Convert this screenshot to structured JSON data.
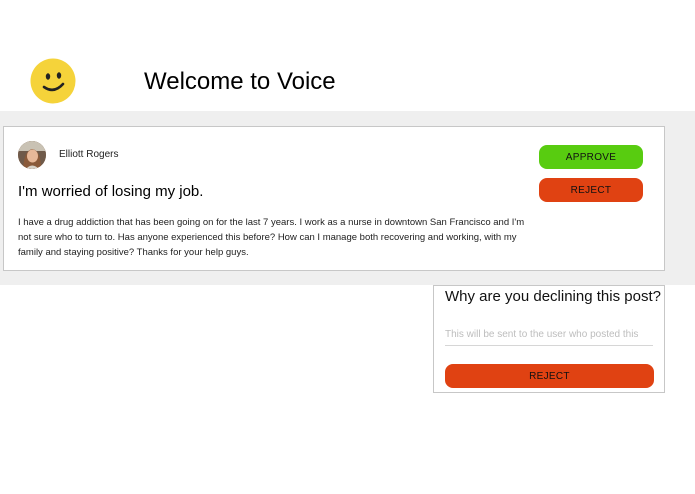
{
  "header": {
    "title": "Welcome to Voice",
    "logo_icon": "smiley-face-icon"
  },
  "colors": {
    "logo_yellow": "#f5d33a",
    "band_gray": "#efefef",
    "approve_green": "#58cc10",
    "reject_red": "#e04212"
  },
  "post": {
    "author": "Elliott Rogers",
    "avatar_icon": "user-avatar-photo",
    "title": "I'm worried of losing my job.",
    "body": "I have a drug addiction that has been going on for the last 7 years. I work as a nurse in downtown San Francisco and I'm not sure who to turn to. Has anyone experienced this before? How can I manage both recovering and working, with my family and staying positive? Thanks for your help guys.",
    "approve_label": "APPROVE",
    "reject_label": "REJECT"
  },
  "decline": {
    "title": "Why are you declining this post?",
    "placeholder": "This will be sent to the user who posted this",
    "value": "",
    "reject_label": "REJECT"
  }
}
